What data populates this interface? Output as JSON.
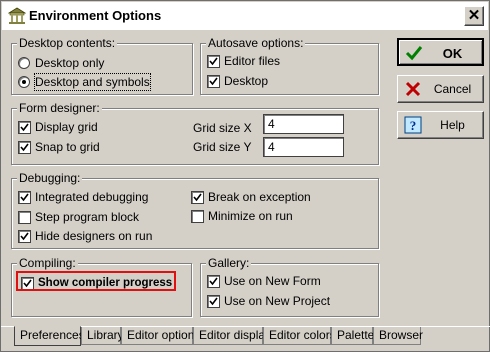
{
  "window": {
    "title": "Environment Options",
    "icon": "temple-icon",
    "close_label": "✕"
  },
  "desktop_contents": {
    "legend": "Desktop contents:",
    "options": [
      {
        "label": "Desktop only",
        "selected": false
      },
      {
        "label": "Desktop and symbols",
        "selected": true
      }
    ]
  },
  "autosave": {
    "legend": "Autosave options:",
    "options": [
      {
        "label": "Editor files",
        "checked": true
      },
      {
        "label": "Desktop",
        "checked": true
      }
    ]
  },
  "form_designer": {
    "legend": "Form designer:",
    "display_grid": "Display grid",
    "snap_to_grid": "Snap to grid",
    "grid_size_x_label": "Grid size X",
    "grid_size_y_label": "Grid size Y",
    "grid_size_x": "4",
    "grid_size_y": "4"
  },
  "debugging": {
    "legend": "Debugging:",
    "integrated_debugging": "Integrated debugging",
    "step_program_block": "Step program block",
    "hide_designers_on_run": "Hide designers on run",
    "break_on_exception": "Break on exception",
    "minimize_on_run": "Minimize on run"
  },
  "compiling": {
    "legend": "Compiling:",
    "show_compiler_progress": "Show compiler progress"
  },
  "gallery": {
    "legend": "Gallery:",
    "use_on_new_form": "Use on New Form",
    "use_on_new_project": "Use on New Project"
  },
  "buttons": {
    "ok": "OK",
    "cancel": "Cancel",
    "help": "Help"
  },
  "tabs": [
    "Preferences",
    "Library",
    "Editor options",
    "Editor display",
    "Editor colors",
    "Palette",
    "Browser"
  ],
  "colors": {
    "highlight": "#e01010",
    "ok_check": "#008000",
    "cancel_x": "#c00000",
    "help_bg": "#c0e8ff"
  }
}
